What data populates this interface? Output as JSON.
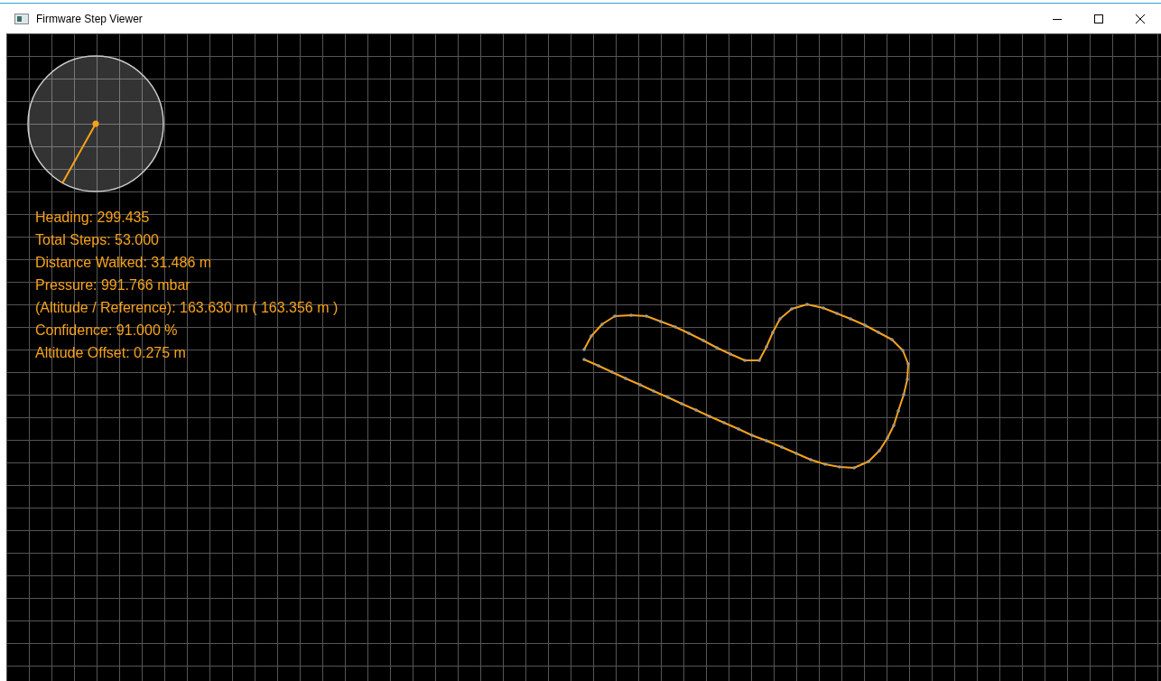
{
  "window": {
    "title": "Firmware Step Viewer"
  },
  "readouts": [
    "Heading: 299.435",
    "Total Steps: 53.000",
    "Distance Walked: 31.486 m",
    "Pressure: 991.766 mbar",
    "(Altitude / Reference): 163.630 m ( 163.356 m )",
    "Confidence: 91.000 %",
    "Altitude Offset: 0.275 m"
  ]
}
